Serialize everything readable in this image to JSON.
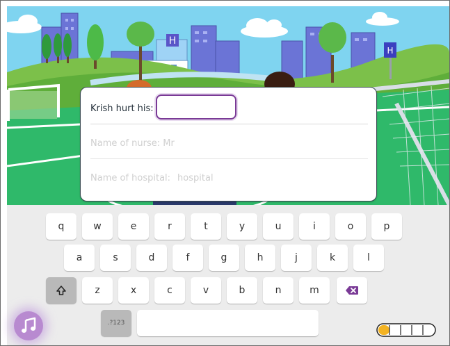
{
  "form": {
    "field1_label": "Krish hurt his:",
    "field1_value": "",
    "field2_label": "Name of nurse: Mr",
    "field3_label": "Name of hospital:",
    "field3_suffix": "hospital"
  },
  "keyboard": {
    "row1": [
      "q",
      "w",
      "e",
      "r",
      "t",
      "y",
      "u",
      "i",
      "o",
      "p"
    ],
    "row2": [
      "a",
      "s",
      "d",
      "f",
      "g",
      "h",
      "j",
      "k",
      "l"
    ],
    "row3": [
      "z",
      "x",
      "c",
      "v",
      "b",
      "n",
      "m"
    ],
    "shift_icon": "shift-arrow-icon",
    "delete_icon": "backspace-icon",
    "numbers_label": ".?123",
    "space_label": ""
  },
  "progress": {
    "filled_fraction": 0.2,
    "segments": 5
  },
  "colors": {
    "accent_purple": "#7a3a96",
    "progress_yellow": "#f3b323"
  },
  "icons": [
    "music-note-icon",
    "shift-arrow-icon",
    "backspace-icon",
    "hospital-sign-icon"
  ]
}
